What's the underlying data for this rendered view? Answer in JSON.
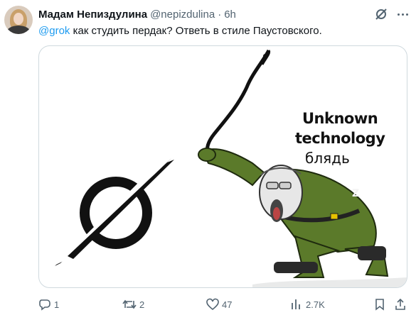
{
  "author": {
    "name": "Мадам Непиздулина",
    "handle": "@nepizdulina",
    "separator": "·",
    "time": "6h"
  },
  "tweet": {
    "mention": "@grok",
    "text": " как студить пердак? Ответь в стиле Паустовского."
  },
  "media": {
    "meme_line1": "Unknown",
    "meme_line2": "technology",
    "meme_line3": "блядь",
    "logo_icon": "grok-logo-icon",
    "character": "wojak-soldier-with-whip"
  },
  "actions": {
    "replies": "1",
    "reposts": "2",
    "likes": "47",
    "views": "2.7K"
  },
  "colors": {
    "accent": "#1d9bf0",
    "secondary_text": "#536471",
    "border": "#cfd9de",
    "uniform": "#5b7a2a"
  }
}
